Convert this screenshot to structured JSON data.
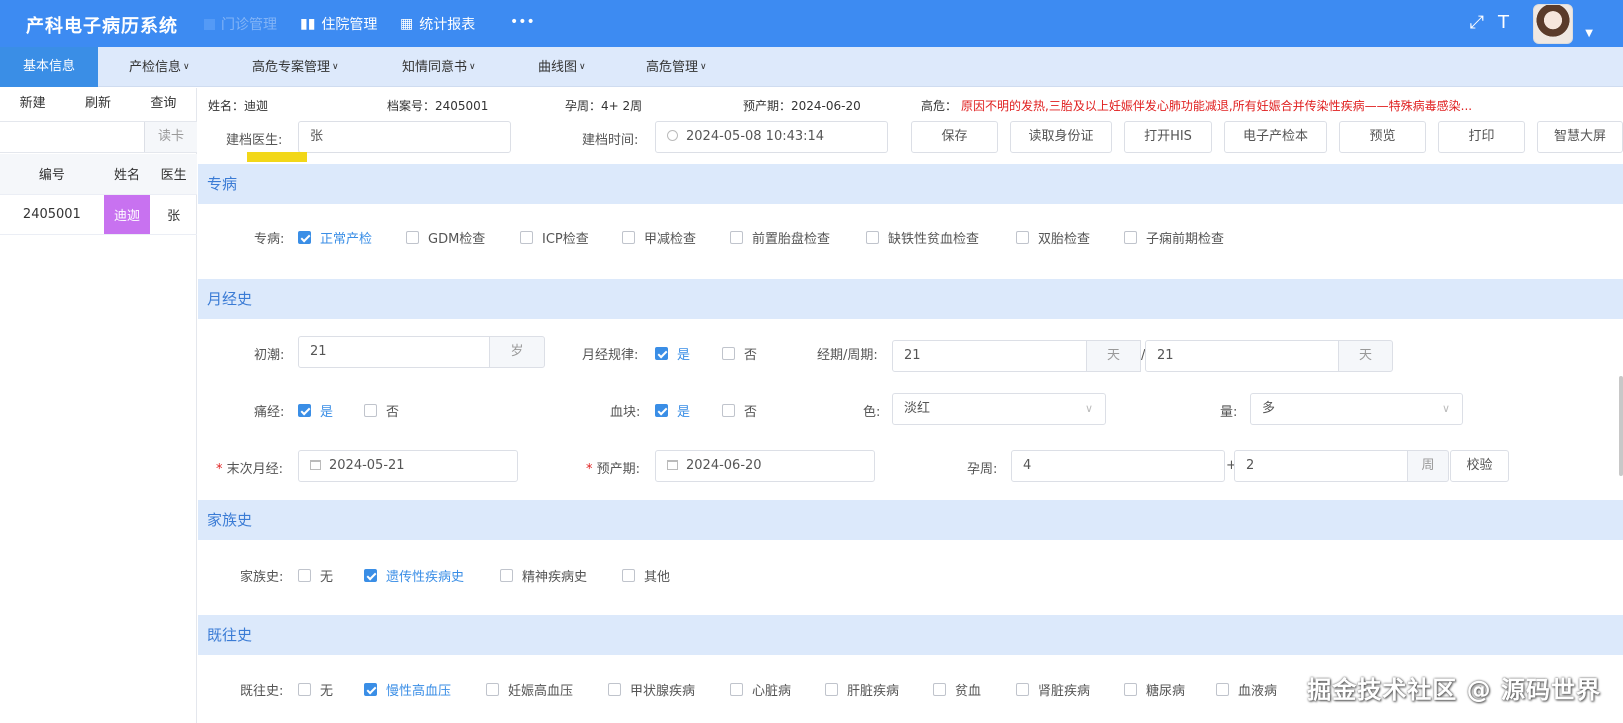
{
  "app": {
    "title": "产科电子病历系统",
    "nav": [
      {
        "label": "门诊管理"
      },
      {
        "label": "住院管理"
      },
      {
        "label": "统计报表"
      },
      {
        "label": "•••"
      }
    ],
    "header_icons": [
      "fullscreen-icon",
      "font-size-icon"
    ]
  },
  "modules": [
    {
      "label": "基本信息",
      "active": true
    },
    {
      "label": "产检信息"
    },
    {
      "label": "高危专案管理"
    },
    {
      "label": "知情同意书"
    },
    {
      "label": "曲线图"
    },
    {
      "label": "高危管理"
    }
  ],
  "left": {
    "actions": [
      "新建",
      "刷新",
      "查询"
    ],
    "read_card": "读卡",
    "columns": [
      "编号",
      "姓名",
      "医生"
    ],
    "rows": [
      {
        "id": "2405001",
        "name": "迪迦",
        "doctor": "张"
      }
    ]
  },
  "patient": {
    "name_label": "姓名：迪迦",
    "archive_label": "档案号：2405001",
    "gestation_label": "孕周：4+ 2周",
    "due_label": "预产期：2024-06-20",
    "risk_label": "高危：",
    "risk_text": "原因不明的发热,三胎及以上妊娠伴发心肺功能减退,所有妊娠合并传染性疾病——特殊病毒感染..."
  },
  "archive": {
    "doctor_label": "建档医生:",
    "doctor_value": "张",
    "time_label": "建档时间:",
    "time_value": "2024-05-08 10:43:14",
    "buttons": [
      "保存",
      "读取身份证",
      "打开HIS",
      "电子产检本",
      "预览",
      "打印",
      "智慧大屏"
    ]
  },
  "special": {
    "title": "专病",
    "label": "专病:",
    "options": [
      {
        "label": "正常产检",
        "checked": true
      },
      {
        "label": "GDM检查",
        "checked": false
      },
      {
        "label": "ICP检查",
        "checked": false
      },
      {
        "label": "甲减检查",
        "checked": false
      },
      {
        "label": "前置胎盘检查",
        "checked": false
      },
      {
        "label": "缺铁性贫血检查",
        "checked": false
      },
      {
        "label": "双胎检查",
        "checked": false
      },
      {
        "label": "子痫前期检查",
        "checked": false
      }
    ]
  },
  "menstrual": {
    "title": "月经史",
    "menarche_label": "初潮:",
    "menarche_value": "21",
    "menarche_unit": "岁",
    "regular_label": "月经规律:",
    "yes": "是",
    "no": "否",
    "period_label": "经期/周期:",
    "period_value": "21",
    "cycle_value": "21",
    "day_unit": "天",
    "slash": "/",
    "pain_label": "痛经:",
    "clot_label": "血块:",
    "color_label": "色:",
    "color_value": "淡红",
    "amount_label": "量:",
    "amount_value": "多",
    "lmp_label": "末次月经:",
    "lmp_value": "2024-05-21",
    "edd_label": "预产期:",
    "edd_value": "2024-06-20",
    "ga_label": "孕周:",
    "ga_weeks": "4",
    "ga_plus": "+",
    "ga_days": "2",
    "week_unit": "周",
    "verify": "校验"
  },
  "family": {
    "title": "家族史",
    "label": "家族史:",
    "options": [
      {
        "label": "无",
        "checked": false
      },
      {
        "label": "遗传性疾病史",
        "checked": true
      },
      {
        "label": "精神疾病史",
        "checked": false
      },
      {
        "label": "其他",
        "checked": false
      }
    ]
  },
  "past": {
    "title": "既往史",
    "label": "既往史:",
    "options": [
      {
        "label": "无",
        "checked": false
      },
      {
        "label": "慢性高血压",
        "checked": true
      },
      {
        "label": "妊娠高血压",
        "checked": false
      },
      {
        "label": "甲状腺疾病",
        "checked": false
      },
      {
        "label": "心脏病",
        "checked": false
      },
      {
        "label": "肝脏疾病",
        "checked": false
      },
      {
        "label": "贫血",
        "checked": false
      },
      {
        "label": "肾脏疾病",
        "checked": false
      },
      {
        "label": "糖尿病",
        "checked": false
      },
      {
        "label": "血液病",
        "checked": false
      }
    ]
  },
  "watermark": "掘金技术社区 @ 源码世界",
  "colors": {
    "primary": "#3d8bf2",
    "accent": "#3a8ee6",
    "section_bg": "#dce9fb",
    "danger": "#e02020",
    "highlight": "#c872f0"
  }
}
